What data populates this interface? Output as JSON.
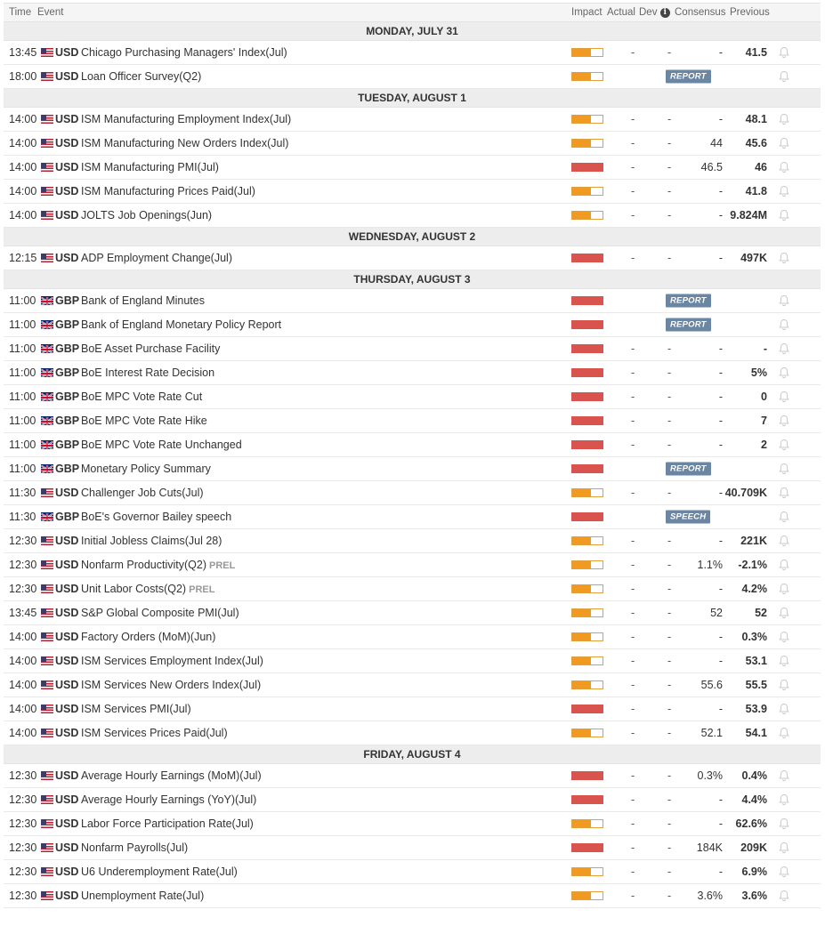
{
  "header": {
    "time": "Time",
    "event": "Event",
    "impact": "Impact",
    "actual": "Actual",
    "dev": "Dev",
    "info_icon": "i",
    "consensus": "Consensus",
    "previous": "Previous"
  },
  "colors": {
    "impact_high": "#d9534f",
    "impact_medium": "#f09a22",
    "badge": "#6b86a3"
  },
  "days": [
    {
      "label": "MONDAY, JULY 31",
      "events": [
        {
          "time": "13:45",
          "flag": "us",
          "currency": "USD",
          "event": "Chicago Purchasing Managers' Index(Jul)",
          "impact": "medium",
          "actual": "-",
          "dev": "-",
          "consensus": "-",
          "previous": "41.5"
        },
        {
          "time": "18:00",
          "flag": "us",
          "currency": "USD",
          "event": "Loan Officer Survey(Q2)",
          "impact": "medium",
          "badge": "REPORT"
        }
      ]
    },
    {
      "label": "TUESDAY, AUGUST 1",
      "events": [
        {
          "time": "14:00",
          "flag": "us",
          "currency": "USD",
          "event": "ISM Manufacturing Employment Index(Jul)",
          "impact": "medium",
          "actual": "-",
          "dev": "-",
          "consensus": "-",
          "previous": "48.1"
        },
        {
          "time": "14:00",
          "flag": "us",
          "currency": "USD",
          "event": "ISM Manufacturing New Orders Index(Jul)",
          "impact": "medium",
          "actual": "-",
          "dev": "-",
          "consensus": "44",
          "previous": "45.6"
        },
        {
          "time": "14:00",
          "flag": "us",
          "currency": "USD",
          "event": "ISM Manufacturing PMI(Jul)",
          "impact": "high",
          "actual": "-",
          "dev": "-",
          "consensus": "46.5",
          "previous": "46"
        },
        {
          "time": "14:00",
          "flag": "us",
          "currency": "USD",
          "event": "ISM Manufacturing Prices Paid(Jul)",
          "impact": "medium",
          "actual": "-",
          "dev": "-",
          "consensus": "-",
          "previous": "41.8"
        },
        {
          "time": "14:00",
          "flag": "us",
          "currency": "USD",
          "event": "JOLTS Job Openings(Jun)",
          "impact": "medium",
          "actual": "-",
          "dev": "-",
          "consensus": "-",
          "previous": "9.824M"
        }
      ]
    },
    {
      "label": "WEDNESDAY, AUGUST 2",
      "events": [
        {
          "time": "12:15",
          "flag": "us",
          "currency": "USD",
          "event": "ADP Employment Change(Jul)",
          "impact": "high",
          "actual": "-",
          "dev": "-",
          "consensus": "-",
          "previous": "497K"
        }
      ]
    },
    {
      "label": "THURSDAY, AUGUST 3",
      "events": [
        {
          "time": "11:00",
          "flag": "gb",
          "currency": "GBP",
          "event": "Bank of England Minutes",
          "impact": "high",
          "badge": "REPORT"
        },
        {
          "time": "11:00",
          "flag": "gb",
          "currency": "GBP",
          "event": "Bank of England Monetary Policy Report",
          "impact": "high",
          "badge": "REPORT"
        },
        {
          "time": "11:00",
          "flag": "gb",
          "currency": "GBP",
          "event": "BoE Asset Purchase Facility",
          "impact": "high",
          "actual": "-",
          "dev": "-",
          "consensus": "-",
          "previous": "-"
        },
        {
          "time": "11:00",
          "flag": "gb",
          "currency": "GBP",
          "event": "BoE Interest Rate Decision",
          "impact": "high",
          "actual": "-",
          "dev": "-",
          "consensus": "-",
          "previous": "5%"
        },
        {
          "time": "11:00",
          "flag": "gb",
          "currency": "GBP",
          "event": "BoE MPC Vote Rate Cut",
          "impact": "high",
          "actual": "-",
          "dev": "-",
          "consensus": "-",
          "previous": "0"
        },
        {
          "time": "11:00",
          "flag": "gb",
          "currency": "GBP",
          "event": "BoE MPC Vote Rate Hike",
          "impact": "high",
          "actual": "-",
          "dev": "-",
          "consensus": "-",
          "previous": "7"
        },
        {
          "time": "11:00",
          "flag": "gb",
          "currency": "GBP",
          "event": "BoE MPC Vote Rate Unchanged",
          "impact": "high",
          "actual": "-",
          "dev": "-",
          "consensus": "-",
          "previous": "2"
        },
        {
          "time": "11:00",
          "flag": "gb",
          "currency": "GBP",
          "event": "Monetary Policy Summary",
          "impact": "high",
          "badge": "REPORT"
        },
        {
          "time": "11:30",
          "flag": "us",
          "currency": "USD",
          "event": "Challenger Job Cuts(Jul)",
          "impact": "medium",
          "actual": "-",
          "dev": "-",
          "consensus": "-",
          "previous": "40.709K"
        },
        {
          "time": "11:30",
          "flag": "gb",
          "currency": "GBP",
          "event": "BoE's Governor Bailey speech",
          "impact": "high",
          "badge": "SPEECH"
        },
        {
          "time": "12:30",
          "flag": "us",
          "currency": "USD",
          "event": "Initial Jobless Claims(Jul 28)",
          "impact": "medium",
          "actual": "-",
          "dev": "-",
          "consensus": "-",
          "previous": "221K"
        },
        {
          "time": "12:30",
          "flag": "us",
          "currency": "USD",
          "event": "Nonfarm Productivity(Q2)",
          "tag": "PREL",
          "impact": "medium",
          "actual": "-",
          "dev": "-",
          "consensus": "1.1%",
          "previous": "-2.1%"
        },
        {
          "time": "12:30",
          "flag": "us",
          "currency": "USD",
          "event": "Unit Labor Costs(Q2)",
          "tag": "PREL",
          "impact": "medium",
          "actual": "-",
          "dev": "-",
          "consensus": "-",
          "previous": "4.2%"
        },
        {
          "time": "13:45",
          "flag": "us",
          "currency": "USD",
          "event": "S&P Global Composite PMI(Jul)",
          "impact": "medium",
          "actual": "-",
          "dev": "-",
          "consensus": "52",
          "previous": "52"
        },
        {
          "time": "14:00",
          "flag": "us",
          "currency": "USD",
          "event": "Factory Orders (MoM)(Jun)",
          "impact": "medium",
          "actual": "-",
          "dev": "-",
          "consensus": "-",
          "previous": "0.3%"
        },
        {
          "time": "14:00",
          "flag": "us",
          "currency": "USD",
          "event": "ISM Services Employment Index(Jul)",
          "impact": "medium",
          "actual": "-",
          "dev": "-",
          "consensus": "-",
          "previous": "53.1"
        },
        {
          "time": "14:00",
          "flag": "us",
          "currency": "USD",
          "event": "ISM Services New Orders Index(Jul)",
          "impact": "medium",
          "actual": "-",
          "dev": "-",
          "consensus": "55.6",
          "previous": "55.5"
        },
        {
          "time": "14:00",
          "flag": "us",
          "currency": "USD",
          "event": "ISM Services PMI(Jul)",
          "impact": "high",
          "actual": "-",
          "dev": "-",
          "consensus": "-",
          "previous": "53.9"
        },
        {
          "time": "14:00",
          "flag": "us",
          "currency": "USD",
          "event": "ISM Services Prices Paid(Jul)",
          "impact": "medium",
          "actual": "-",
          "dev": "-",
          "consensus": "52.1",
          "previous": "54.1"
        }
      ]
    },
    {
      "label": "FRIDAY, AUGUST 4",
      "events": [
        {
          "time": "12:30",
          "flag": "us",
          "currency": "USD",
          "event": "Average Hourly Earnings (MoM)(Jul)",
          "impact": "high",
          "actual": "-",
          "dev": "-",
          "consensus": "0.3%",
          "previous": "0.4%"
        },
        {
          "time": "12:30",
          "flag": "us",
          "currency": "USD",
          "event": "Average Hourly Earnings (YoY)(Jul)",
          "impact": "high",
          "actual": "-",
          "dev": "-",
          "consensus": "-",
          "previous": "4.4%"
        },
        {
          "time": "12:30",
          "flag": "us",
          "currency": "USD",
          "event": "Labor Force Participation Rate(Jul)",
          "impact": "medium",
          "actual": "-",
          "dev": "-",
          "consensus": "-",
          "previous": "62.6%"
        },
        {
          "time": "12:30",
          "flag": "us",
          "currency": "USD",
          "event": "Nonfarm Payrolls(Jul)",
          "impact": "high",
          "actual": "-",
          "dev": "-",
          "consensus": "184K",
          "previous": "209K"
        },
        {
          "time": "12:30",
          "flag": "us",
          "currency": "USD",
          "event": "U6 Underemployment Rate(Jul)",
          "impact": "medium",
          "actual": "-",
          "dev": "-",
          "consensus": "-",
          "previous": "6.9%"
        },
        {
          "time": "12:30",
          "flag": "us",
          "currency": "USD",
          "event": "Unemployment Rate(Jul)",
          "impact": "medium",
          "actual": "-",
          "dev": "-",
          "consensus": "3.6%",
          "previous": "3.6%"
        }
      ]
    }
  ]
}
